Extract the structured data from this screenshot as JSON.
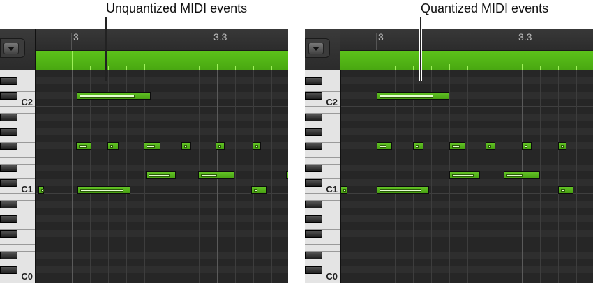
{
  "captions": {
    "left": "Unquantized MIDI events",
    "right": "Quantized MIDI events"
  },
  "ruler": {
    "bar_label": "3",
    "beat_label": "3.3"
  },
  "keyboard": {
    "labels": [
      "C2",
      "C1",
      "C0"
    ]
  },
  "colors": {
    "note": "#52b31a",
    "region": "#55b816",
    "grid": "#262626"
  },
  "panels": [
    {
      "id": "unquantized",
      "notes": [
        {
          "pitch": 13,
          "start": 0.07,
          "length": 1.02,
          "velocity": 0.8
        },
        {
          "pitch": 6,
          "start": 0.06,
          "length": 0.21,
          "velocity": 0.7
        },
        {
          "pitch": 6,
          "start": 0.49,
          "length": 0.15,
          "velocity": 0.2
        },
        {
          "pitch": 6,
          "start": 0.99,
          "length": 0.23,
          "velocity": 0.7
        },
        {
          "pitch": 6,
          "start": 1.51,
          "length": 0.13,
          "velocity": 0.1
        },
        {
          "pitch": 6,
          "start": 1.98,
          "length": 0.13,
          "velocity": 0.3
        },
        {
          "pitch": 6,
          "start": 2.49,
          "length": 0.12,
          "velocity": 0.2
        },
        {
          "pitch": 2,
          "start": 1.02,
          "length": 0.41,
          "velocity": 0.85
        },
        {
          "pitch": 2,
          "start": 1.74,
          "length": 0.5,
          "velocity": 0.5
        },
        {
          "pitch": 2,
          "start": 2.95,
          "length": 0.3,
          "velocity": 0.5
        },
        {
          "pitch": 0,
          "start": -0.46,
          "length": 0.08,
          "velocity": 0.0
        },
        {
          "pitch": 0,
          "start": 0.08,
          "length": 0.73,
          "velocity": 0.9
        },
        {
          "pitch": 0,
          "start": 2.47,
          "length": 0.21,
          "velocity": 0.3
        }
      ]
    },
    {
      "id": "quantized",
      "notes": [
        {
          "pitch": 13,
          "start": 0.0,
          "length": 1.0,
          "velocity": 0.8
        },
        {
          "pitch": 6,
          "start": 0.0,
          "length": 0.21,
          "velocity": 0.7
        },
        {
          "pitch": 6,
          "start": 0.5,
          "length": 0.14,
          "velocity": 0.2
        },
        {
          "pitch": 6,
          "start": 1.0,
          "length": 0.22,
          "velocity": 0.7
        },
        {
          "pitch": 6,
          "start": 1.5,
          "length": 0.13,
          "velocity": 0.1
        },
        {
          "pitch": 6,
          "start": 2.0,
          "length": 0.13,
          "velocity": 0.3
        },
        {
          "pitch": 6,
          "start": 2.5,
          "length": 0.12,
          "velocity": 0.2
        },
        {
          "pitch": 2,
          "start": 1.0,
          "length": 0.42,
          "velocity": 0.85
        },
        {
          "pitch": 2,
          "start": 1.75,
          "length": 0.5,
          "velocity": 0.5
        },
        {
          "pitch": 0,
          "start": -0.5,
          "length": 0.1,
          "velocity": 0.0
        },
        {
          "pitch": 0,
          "start": 0.0,
          "length": 0.72,
          "velocity": 0.9
        },
        {
          "pitch": 0,
          "start": 2.5,
          "length": 0.21,
          "velocity": 0.3
        }
      ]
    }
  ]
}
